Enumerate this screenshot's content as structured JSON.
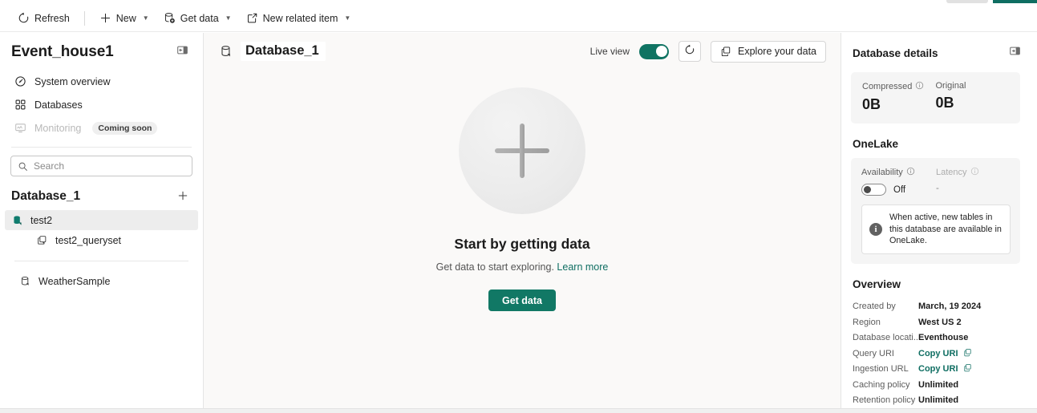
{
  "commandbar": {
    "items": [
      {
        "label": "Refresh",
        "icon": "refresh-icon",
        "caret": false
      },
      {
        "label": "New",
        "icon": "plus-icon",
        "caret": true
      },
      {
        "label": "Get data",
        "icon": "database-get-icon",
        "caret": true
      },
      {
        "label": "New related item",
        "icon": "external-link-icon",
        "caret": true
      }
    ]
  },
  "sidebar": {
    "title": "Event_house1",
    "collapse_icon": "panel-collapse-icon",
    "nav": [
      {
        "label": "System overview",
        "icon": "gauge-icon",
        "disabled": false,
        "badge": ""
      },
      {
        "label": "Databases",
        "icon": "grid-icon",
        "disabled": false,
        "badge": ""
      },
      {
        "label": "Monitoring",
        "icon": "monitor-icon",
        "disabled": true,
        "badge": "Coming soon"
      }
    ],
    "search": {
      "placeholder": "Search",
      "value": "",
      "icon": "search-icon"
    },
    "database_section": {
      "title": "Database_1",
      "add_icon": "plus-icon"
    },
    "tree": [
      {
        "label": "test2",
        "icon": "database-icon",
        "selected": true,
        "indent": false,
        "loose": false
      },
      {
        "label": "test2_queryset",
        "icon": "queryset-icon",
        "selected": false,
        "indent": true,
        "loose": false
      },
      {
        "label": "WeatherSample",
        "icon": "database-icon",
        "selected": false,
        "indent": false,
        "loose": true
      }
    ]
  },
  "main": {
    "title": "Database_1",
    "title_icon": "database-icon",
    "live_view_label": "Live view",
    "live_view_on": true,
    "refresh_icon": "refresh-icon",
    "explore_button": {
      "label": "Explore your data",
      "icon": "copy-icon"
    },
    "empty_state": {
      "illustration": "plus-circle-illustration",
      "title": "Start by getting data",
      "subtitle": "Get data to start exploring.",
      "link": "Learn more",
      "button_label": "Get data"
    }
  },
  "right_panel": {
    "title": "Database details",
    "collapse_icon": "panel-collapse-icon",
    "stats": [
      {
        "label": "Compressed",
        "info_icon": "info-circle-icon",
        "value": "0B"
      },
      {
        "label": "Original",
        "info_icon": "",
        "value": "0B"
      }
    ],
    "onelake": {
      "section_title": "OneLake",
      "availability": {
        "label": "Availability",
        "info_icon": "info-circle-icon",
        "state": "Off",
        "on": false
      },
      "latency": {
        "label": "Latency",
        "info_icon": "info-circle-icon",
        "value": "-"
      },
      "info_note": {
        "icon": "info-filled-icon",
        "text": "When active, new tables in this database are available in OneLake."
      }
    },
    "overview": {
      "section_title": "Overview",
      "rows": [
        {
          "key": "Created by",
          "value": "March, 19 2024",
          "link": false,
          "copy_icon": ""
        },
        {
          "key": "Region",
          "value": "West US 2",
          "link": false,
          "copy_icon": ""
        },
        {
          "key": "Database locati...",
          "value": "Eventhouse",
          "link": false,
          "copy_icon": ""
        },
        {
          "key": "Query URI",
          "value": "Copy URI",
          "link": true,
          "copy_icon": "copy-icon"
        },
        {
          "key": "Ingestion URL",
          "value": "Copy URI",
          "link": true,
          "copy_icon": "copy-icon"
        },
        {
          "key": "Caching policy",
          "value": "Unlimited",
          "link": false,
          "copy_icon": ""
        },
        {
          "key": "Retention policy",
          "value": "Unlimited",
          "link": false,
          "copy_icon": ""
        }
      ]
    }
  },
  "colors": {
    "accent_teal": "#117865",
    "toggle_on": "#0f7362",
    "link_teal": "#0f6e62",
    "main_bg": "#faf9f8"
  }
}
